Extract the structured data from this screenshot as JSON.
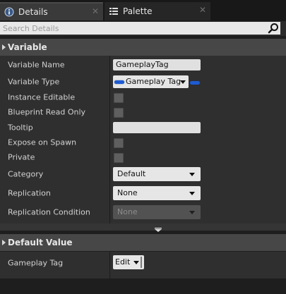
{
  "tabs": {
    "details": {
      "label": "Details",
      "icon": "info-icon"
    },
    "palette": {
      "label": "Palette",
      "icon": "palette-list-icon"
    },
    "close_glyph": "✕"
  },
  "search": {
    "placeholder": "Search Details",
    "icon": "search-icon"
  },
  "sections": {
    "variable": {
      "title": "Variable",
      "variable_name": {
        "label": "Variable Name",
        "value": "GameplayTag"
      },
      "variable_type": {
        "label": "Variable Type",
        "value": "Gameplay Tag",
        "pin_color": "#1e5bd2"
      },
      "instance_editable": {
        "label": "Instance Editable",
        "checked": false
      },
      "blueprint_read_only": {
        "label": "Blueprint Read Only",
        "checked": false
      },
      "tooltip": {
        "label": "Tooltip",
        "value": ""
      },
      "expose_on_spawn": {
        "label": "Expose on Spawn",
        "checked": false
      },
      "private": {
        "label": "Private",
        "checked": false
      },
      "category": {
        "label": "Category",
        "value": "Default"
      },
      "replication": {
        "label": "Replication",
        "value": "None"
      },
      "replication_condition": {
        "label": "Replication Condition",
        "value": "None",
        "enabled": false
      }
    },
    "default_value": {
      "title": "Default Value",
      "gameplay_tag": {
        "label": "Gameplay Tag",
        "button": "Edit"
      }
    }
  },
  "colors": {
    "panel_bg": "#2f2f2f",
    "header_bg": "#474747",
    "accent_blue": "#1e5bd2"
  }
}
